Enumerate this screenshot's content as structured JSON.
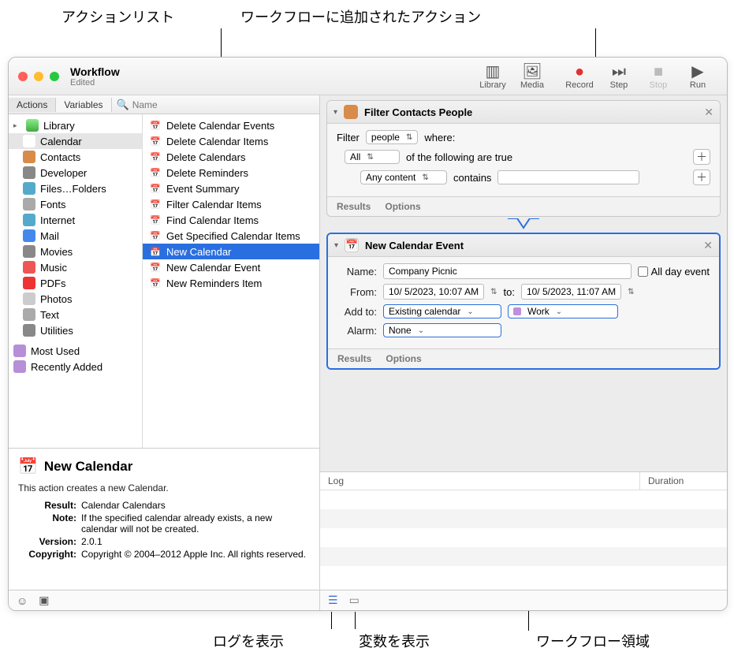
{
  "annotations": {
    "action_list": "アクションリスト",
    "added_action": "ワークフローに追加されたアクション",
    "show_log": "ログを表示",
    "show_variables": "変数を表示",
    "workflow_area": "ワークフロー領域"
  },
  "window": {
    "title": "Workflow",
    "subtitle": "Edited"
  },
  "toolbar": {
    "library": "Library",
    "media": "Media",
    "record": "Record",
    "step": "Step",
    "stop": "Stop",
    "run": "Run"
  },
  "tabs": {
    "actions": "Actions",
    "variables": "Variables"
  },
  "search": {
    "placeholder": "Name"
  },
  "sidebar": {
    "header": "Library",
    "items": [
      {
        "label": "Calendar",
        "selected": true
      },
      {
        "label": "Contacts"
      },
      {
        "label": "Developer"
      },
      {
        "label": "Files…Folders"
      },
      {
        "label": "Fonts"
      },
      {
        "label": "Internet"
      },
      {
        "label": "Mail"
      },
      {
        "label": "Movies"
      },
      {
        "label": "Music"
      },
      {
        "label": "PDFs"
      },
      {
        "label": "Photos"
      },
      {
        "label": "Text"
      },
      {
        "label": "Utilities"
      }
    ],
    "smart": [
      {
        "label": "Most Used"
      },
      {
        "label": "Recently Added"
      }
    ]
  },
  "actions": [
    {
      "label": "Delete Calendar Events"
    },
    {
      "label": "Delete Calendar Items"
    },
    {
      "label": "Delete Calendars"
    },
    {
      "label": "Delete Reminders"
    },
    {
      "label": "Event Summary"
    },
    {
      "label": "Filter Calendar Items"
    },
    {
      "label": "Find Calendar Items"
    },
    {
      "label": "Get Specified Calendar Items"
    },
    {
      "label": "New Calendar",
      "selected": true
    },
    {
      "label": "New Calendar Event"
    },
    {
      "label": "New Reminders Item"
    }
  ],
  "info": {
    "title": "New Calendar",
    "desc": "This action creates a new Calendar.",
    "result_k": "Result:",
    "result_v": "Calendar Calendars",
    "note_k": "Note:",
    "note_v": "If the specified calendar already exists, a new calendar will not be created.",
    "version_k": "Version:",
    "version_v": "2.0.1",
    "copyright_k": "Copyright:",
    "copyright_v": "Copyright © 2004–2012 Apple Inc.  All rights reserved."
  },
  "workflow": {
    "card1": {
      "title": "Filter Contacts People",
      "filter_label": "Filter",
      "filter_value": "people",
      "where": "where:",
      "all": "All",
      "of_following": "of the following are true",
      "any_content": "Any content",
      "contains": "contains",
      "results": "Results",
      "options": "Options"
    },
    "card2": {
      "title": "New Calendar Event",
      "name_k": "Name:",
      "name_v": "Company Picnic",
      "allday": "All day event",
      "from_k": "From:",
      "from_v": "10/ 5/2023, 10:07 AM",
      "to_k": "to:",
      "to_v": "10/ 5/2023, 11:07 AM",
      "addto_k": "Add to:",
      "addto_v": "Existing calendar",
      "cal_v": "Work",
      "alarm_k": "Alarm:",
      "alarm_v": "None",
      "results": "Results",
      "options": "Options"
    }
  },
  "log": {
    "log_h": "Log",
    "duration_h": "Duration"
  }
}
